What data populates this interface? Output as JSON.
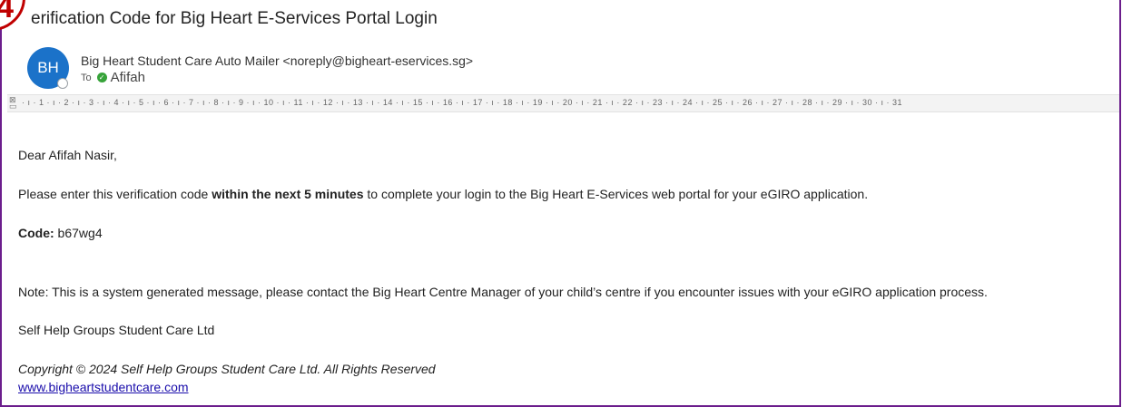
{
  "email": {
    "subject": "erification Code for Big Heart E-Services Portal Login",
    "badge_number": "4",
    "sender": {
      "initials": "BH",
      "display": "Big Heart Student Care Auto Mailer <noreply@bigheart-eservices.sg>"
    },
    "recipients": {
      "to_label": "To",
      "name": "Afifah"
    },
    "ruler": {
      "numbers": "· ı · 1 · ı · 2 · ı · 3 · ı · 4 · ı · 5 · ı · 6 · ı · 7 · ı · 8 · ı · 9 · ı · 10 · ı · 11 · ı · 12 · ı · 13 · ı · 14 · ı · 15 · ı · 16 · ı · 17 · ı · 18 · ı · 19 · ı · 20 · ı · 21 · ı · 22 · ı · 23 · ı · 24 · ı · 25 · ı · 26 · ı · 27 · ı · 28 · ı · 29 · ı · 30 · ı · 31"
    },
    "body": {
      "greeting": "Dear Afifah Nasir,",
      "instruction_pre": "Please enter this verification code ",
      "instruction_bold": "within the next 5 minutes",
      "instruction_post": " to complete your login to the Big Heart E-Services web portal for your eGIRO application.",
      "code_label": "Code:",
      "code_value": " b67wg4",
      "note": "Note: This is a system generated message, please contact the Big Heart Centre Manager of your child’s centre if you encounter issues with your eGIRO application process.",
      "signature": "Self Help Groups Student Care Ltd",
      "copyright": "Copyright © 2024 Self Help Groups Student Care Ltd. All Rights Reserved",
      "website": "www.bigheartstudentcare.com"
    }
  },
  "colors": {
    "frame": "#6b1d8c",
    "badge": "#c00000",
    "avatar": "#1b72c9",
    "link": "#1a0dab",
    "presence_check": "#37a33a"
  }
}
